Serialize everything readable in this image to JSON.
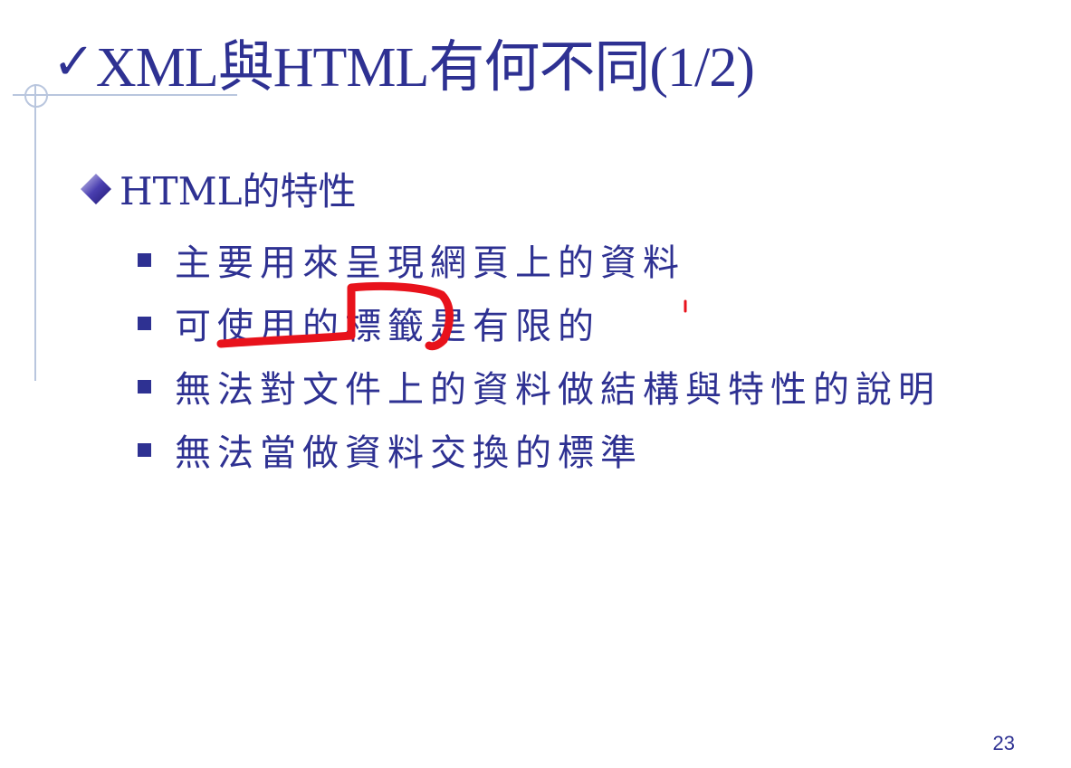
{
  "slide": {
    "title": "XML與HTML有何不同(1/2)",
    "title_icon": "checkmark-icon",
    "heading": "HTML的特性",
    "heading_icon": "diamond-bullet-icon",
    "bullets": [
      "主要用來呈現網頁上的資料",
      "可使用的標籤是有限的",
      "無法對文件上的資料做結構與特性的說明",
      "無法當做資料交換的標準"
    ],
    "page_number": "23"
  },
  "colors": {
    "text": "#2e3192",
    "annotation": "#e8121b",
    "decoration": "#b9c6de"
  }
}
